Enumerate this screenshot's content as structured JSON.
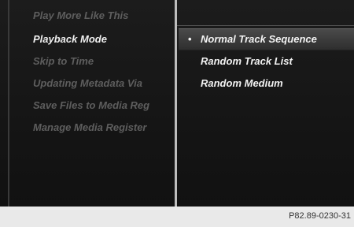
{
  "left_menu": {
    "items": [
      {
        "label": "Play More Like This",
        "state": "dim"
      },
      {
        "label": "Playback Mode",
        "state": "active"
      },
      {
        "label": "Skip to Time",
        "state": "dim"
      },
      {
        "label": "Updating Metadata Via",
        "state": "dim"
      },
      {
        "label": "Save Files to Media Reg",
        "state": "dim"
      },
      {
        "label": "Manage Media Register",
        "state": "dim"
      }
    ]
  },
  "playback_options": {
    "items": [
      {
        "label": "Normal Track Sequence",
        "selected": true
      },
      {
        "label": "Random Track List",
        "selected": false
      },
      {
        "label": "Random Medium",
        "selected": false
      }
    ],
    "selected_marker": "•"
  },
  "footer": {
    "figure_code": "P82.89-0230-31"
  }
}
